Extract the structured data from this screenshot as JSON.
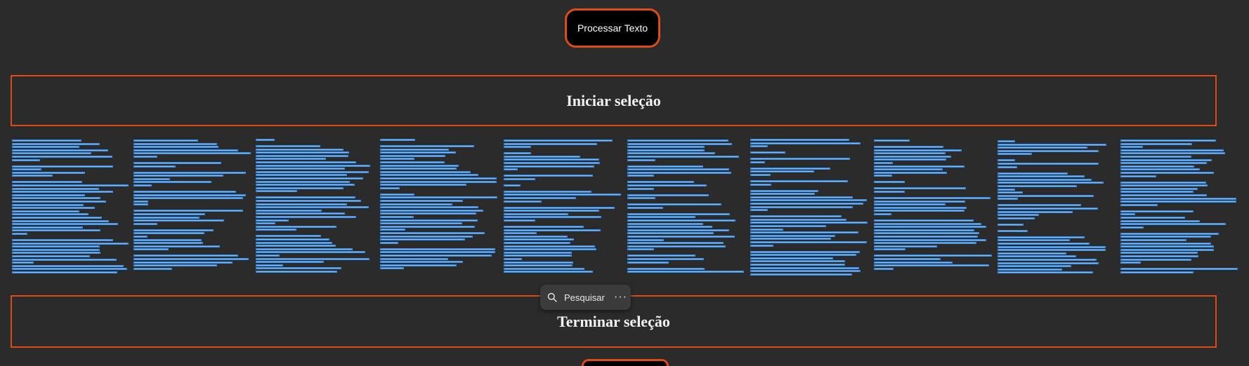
{
  "buttons": {
    "process_label": "Processar Texto"
  },
  "selection": {
    "start_label": "Iniciar seleção",
    "end_label": "Terminar seleção"
  },
  "context_toolbar": {
    "search_label": "Pesquisar",
    "more_label": "···",
    "search_icon": "search-icon",
    "more_icon": "more-icon"
  },
  "colors": {
    "accent": "#e04a14",
    "background": "#2b2b2b",
    "selection_highlight": "#3a8de0"
  }
}
